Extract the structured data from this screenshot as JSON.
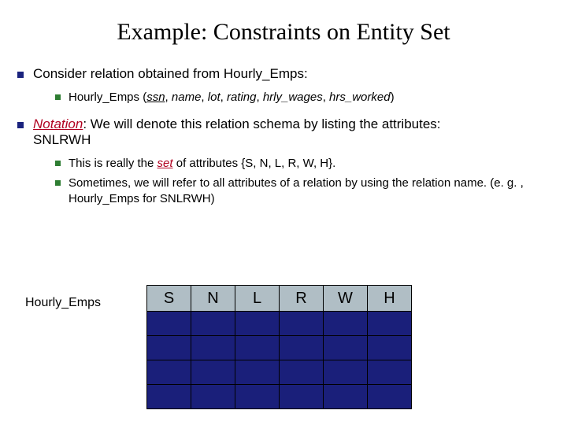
{
  "title": "Example:  Constraints on Entity Set",
  "b1": "Consider relation obtained from Hourly_Emps:",
  "b1a_prefix": "Hourly_Emps (",
  "b1a_key": "ssn",
  "b1a_sep0": ", ",
  "b1a_a1": "name",
  "b1a_sep1": ", ",
  "b1a_a2": "lot",
  "b1a_sep2": ", ",
  "b1a_a3": "rating",
  "b1a_sep3": ", ",
  "b1a_a4": "hrly_wages",
  "b1a_sep4": ", ",
  "b1a_a5": "hrs_worked",
  "b1a_suffix": ")",
  "b2_label": "Notation",
  "b2_colon": ": ",
  "b2_rest": "We will denote this relation schema by listing the attributes:",
  "b2_code": "SNLRWH",
  "b2a_p1": "This is really the ",
  "b2a_set": "set",
  "b2a_p2": " of attributes {S, N, L, R, W, H}.",
  "b2b": "Sometimes, we will refer to all attributes of a relation by using the relation name. (e. g. , Hourly_Emps for SNLRWH)",
  "tableLabel": "Hourly_Emps",
  "cols": {
    "c0": "S",
    "c1": "N",
    "c2": "L",
    "c3": "R",
    "c4": "W",
    "c5": "H"
  }
}
